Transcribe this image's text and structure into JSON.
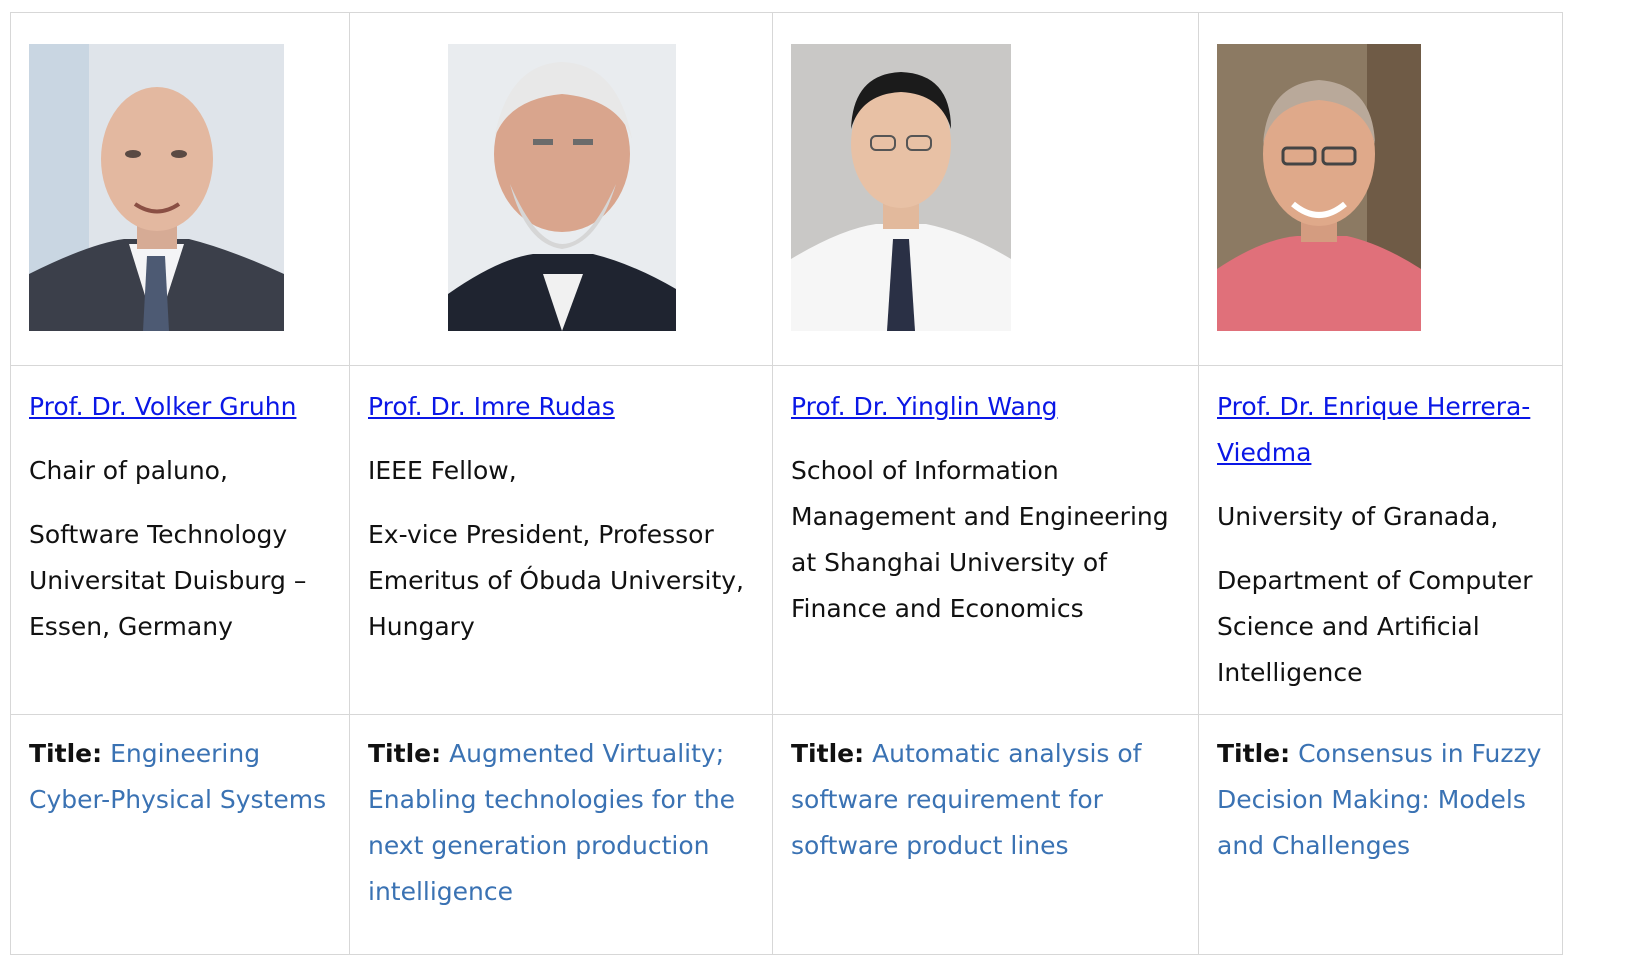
{
  "speakers": [
    {
      "name": "Prof. Dr. Volker Gruhn",
      "affiliation": [
        "Chair of paluno,",
        "Software Technology Universitat Duisburg – Essen, Germany"
      ],
      "title_label": "Title:",
      "title": "Engineering Cyber-Physical Systems"
    },
    {
      "name": "Prof. Dr. Imre Rudas",
      "affiliation": [
        "IEEE Fellow,",
        "Ex-vice President, Professor Emeritus of Óbuda University, Hungary"
      ],
      "title_label": "Title:",
      "title": "Augmented Virtuality; Enabling technologies for the next generation production intelligence"
    },
    {
      "name": "Prof. Dr. Yinglin Wang",
      "affiliation": [
        "School of Information Management and Engineering at Shanghai University of Finance and Economics"
      ],
      "title_label": "Title:",
      "title": "Automatic analysis of software requirement for software product lines"
    },
    {
      "name": "Prof. Dr. Enrique Herrera-Viedma",
      "affiliation": [
        "University of Granada,",
        "Department of Computer Science and Artificial Intelligence"
      ],
      "title_label": "Title:",
      "title": "Consensus in Fuzzy Decision Making: Models and Challenges"
    }
  ],
  "colors": {
    "link": "#0a17e6",
    "title_text": "#3a72b3",
    "border": "#d7d7d7"
  }
}
